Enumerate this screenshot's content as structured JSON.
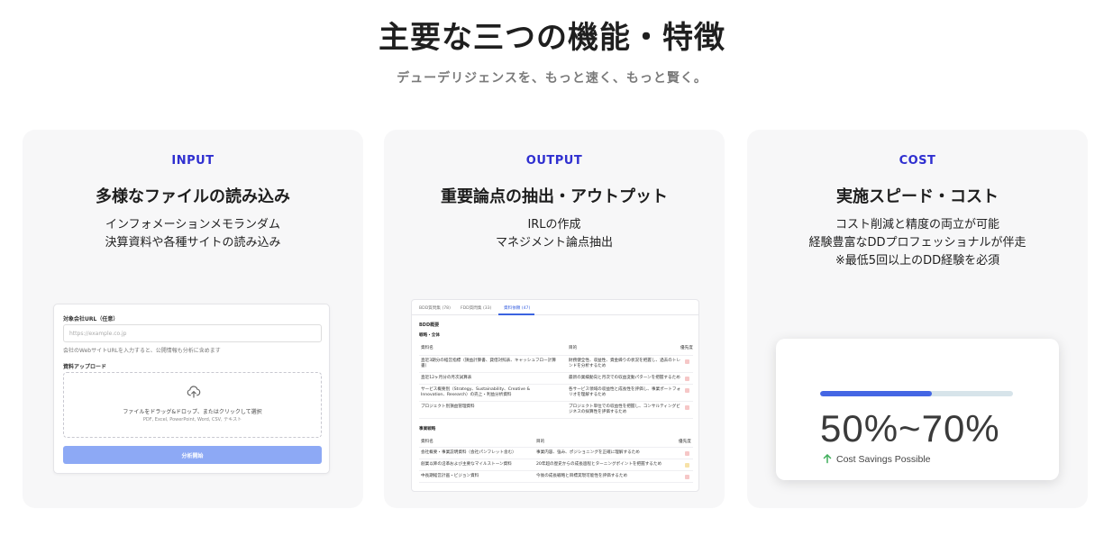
{
  "header": {
    "title": "主要な三つの機能・特徴",
    "subtitle": "デューデリジェンスを、もっと速く、もっと賢く。"
  },
  "cards": [
    {
      "tag": "INPUT",
      "title": "多様なファイルの読み込み",
      "desc": [
        "インフォメーションメモランダム",
        "決算資料や各種サイトの読み込み"
      ],
      "form": {
        "url_label": "対象会社URL（任意）",
        "url_placeholder": "https://example.co.jp",
        "url_hint": "会社のWebサイトURLを入力すると、公開情報も分析に含めます",
        "upload_label": "資料アップロード",
        "drop_text": "ファイルをドラッグ&ドロップ、またはクリックして選択",
        "drop_formats": "PDF, Excel, PowerPoint, Word, CSV, テキスト",
        "submit_label": "分析開始"
      }
    },
    {
      "tag": "OUTPUT",
      "title": "重要論点の抽出・アウトプット",
      "desc": [
        "IRLの作成",
        "マネジメント論点抽出"
      ],
      "table": {
        "tabs": [
          "BDD質問集 (78)",
          "FDD質問集 (33)",
          "資料依頼 (47)"
        ],
        "section": "BDD概要",
        "group1": "戦略・全体",
        "cols1": [
          "資料名",
          "目的",
          "優先度"
        ],
        "rows1": [
          {
            "name": "直近3期分の経営指標（損益計算書、貸借対照表、キャッシュフロー計算書）",
            "purpose": "財務健全性、収益性、資金繰りの状況を把握し、過去のトレンドを分析するため"
          },
          {
            "name": "直近12ヶ月分の月次試算表",
            "purpose": "最新の業績動向と月次での収益変動パターンを把握するため"
          },
          {
            "name": "サービス概要別（Strategy、Sustainability、Creative & Innovation、Research）の売上・利益分析資料",
            "purpose": "各サービス領域の収益性と成長性を評価し、事業ポートフォリオを理解するため"
          },
          {
            "name": "プロジェクト別損益管理資料",
            "purpose": "プロジェクト単位での収益性を把握し、コンサルティングビジネスの採算性を評価するため"
          }
        ],
        "group2": "事業戦略",
        "cols2": [
          "資料名",
          "目的",
          "優先度"
        ],
        "rows2": [
          {
            "name": "会社概要・事業説明資料（会社パンフレット含む）",
            "purpose": "事業内容、強み、ポジショニングを正確に理解するため"
          },
          {
            "name": "創業以降の沿革および主要なマイルストーン資料",
            "purpose": "20年超の歴史からの成長過程とターニングポイントを把握するため"
          },
          {
            "name": "中長期経営計画・ビジョン資料",
            "purpose": "今後の成長戦略と目標実現可能性を評価するため"
          }
        ]
      }
    },
    {
      "tag": "COST",
      "title": "実施スピード・コスト",
      "desc": [
        "コスト削減と精度の両立が可能",
        "経験豊富なDDプロフェッショナルが伴走",
        "※最低5回以上のDD経験を必須"
      ],
      "savings": {
        "value": "50%~70%",
        "label": "Cost Savings Possible",
        "progress": 0.58
      }
    }
  ],
  "colors": {
    "accent": "#2f2fd0",
    "progress": "#4466e4",
    "priority_high": "#f6c7c7",
    "priority_mid": "#f7e2a8"
  }
}
